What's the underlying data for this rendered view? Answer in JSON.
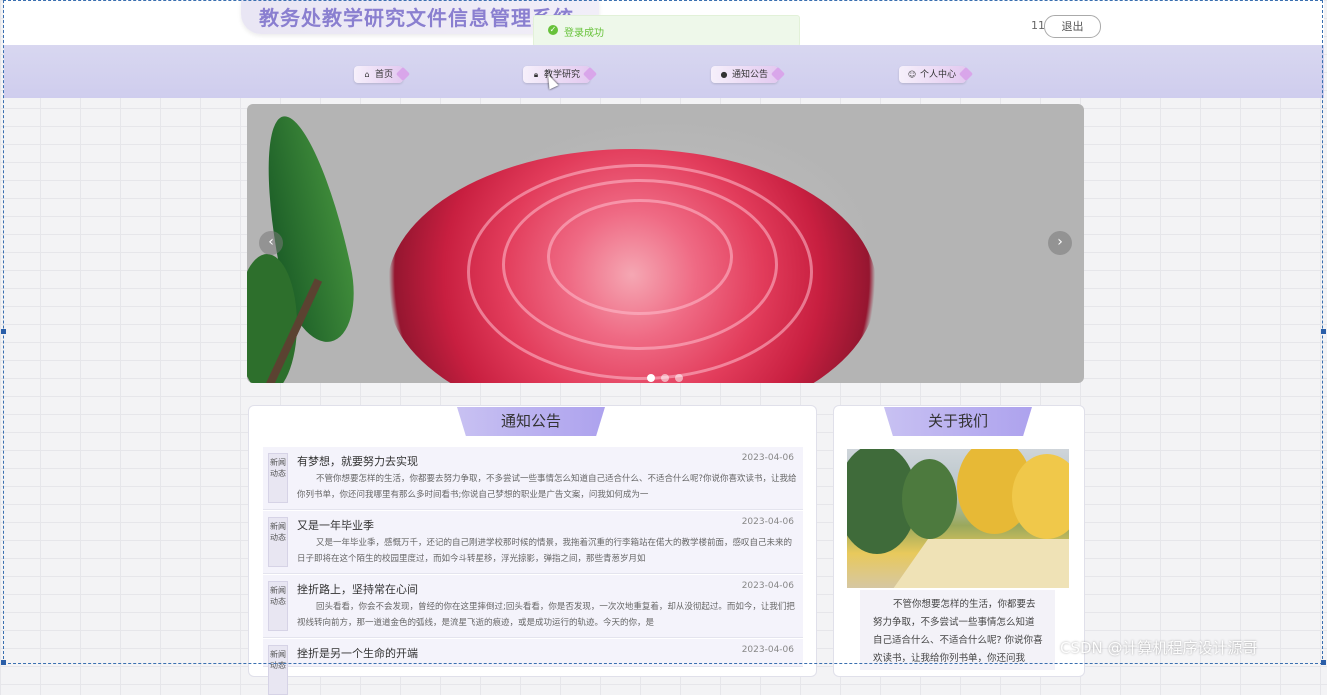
{
  "header": {
    "site_title": "教务处教学研究文件信息管理系统",
    "user_name": "11",
    "logout_label": "退出"
  },
  "toast": {
    "message": "登录成功"
  },
  "nav": {
    "items": [
      {
        "label": "首页",
        "icon": "home-icon"
      },
      {
        "label": "教学研究",
        "icon": "lock-icon"
      },
      {
        "label": "通知公告",
        "icon": "info-icon"
      },
      {
        "label": "个人中心",
        "icon": "user-icon"
      }
    ]
  },
  "carousel": {
    "slide_count": 3,
    "active_index": 0
  },
  "notice": {
    "heading": "通知公告",
    "items": [
      {
        "tag": "新闻动态",
        "title": "有梦想，就要努力去实现",
        "date": "2023-04-06",
        "body": "不管你想要怎样的生活，你都要去努力争取，不多尝试一些事情怎么知道自己适合什么、不适合什么呢?你说你喜欢读书，让我给你列书单，你还问我哪里有那么多时间看书;你说自己梦想的职业是广告文案，问我如何成为一"
      },
      {
        "tag": "新闻动态",
        "title": "又是一年毕业季",
        "date": "2023-04-06",
        "body": "又是一年毕业季，感慨万千，还记的自己刚进学校那时候的情景，我拖着沉重的行李箱站在偌大的教学楼前面，感叹自己未来的日子即将在这个陌生的校园里度过，而如今斗转星移，浮光掠影，弹指之间，那些青葱岁月如"
      },
      {
        "tag": "新闻动态",
        "title": "挫折路上，坚持常在心间",
        "date": "2023-04-06",
        "body": "回头看看，你会不会发现，曾经的你在这里摔倒过;回头看看，你是否发现，一次次地重复着，却从没彻起过。而如今，让我们把视线转向前方，那一道道金色的弧线，是流星飞逝的痕迹，或是成功运行的轨迹。今天的你，是"
      },
      {
        "tag": "新闻动态",
        "title": "挫折是另一个生命的开端",
        "date": "2023-04-06",
        "body": ""
      }
    ]
  },
  "about": {
    "heading": "关于我们",
    "text": "不管你想要怎样的生活，你都要去努力争取，不多尝试一些事情怎么知道自己适合什么、不适合什么呢? 你说你喜欢读书，让我给你列书单，你还问我"
  },
  "watermark": "CSDN @计算机程序设计源哥"
}
